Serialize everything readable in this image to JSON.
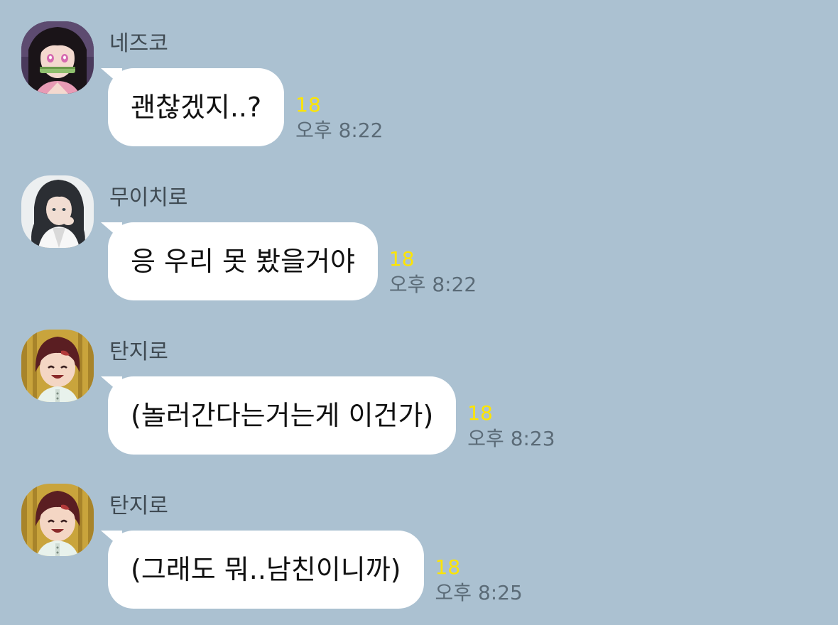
{
  "messages": [
    {
      "sender": "네즈코",
      "text": "괜찮겠지..?",
      "unread": "18",
      "time": "오후 8:22",
      "avatar": "nezuko-avatar"
    },
    {
      "sender": "무이치로",
      "text": "응 우리 못 봤을거야",
      "unread": "18",
      "time": "오후 8:22",
      "avatar": "muichiro-avatar"
    },
    {
      "sender": "탄지로",
      "text": "(놀러간다는거는게 이건가)",
      "unread": "18",
      "time": "오후 8:23",
      "avatar": "tanjiro-avatar"
    },
    {
      "sender": "탄지로",
      "text": "(그래도 뭐..남친이니까)",
      "unread": "18",
      "time": "오후 8:25",
      "avatar": "tanjiro-avatar"
    }
  ],
  "colors": {
    "background": "#abc1d1",
    "bubble": "#ffffff",
    "unread": "#fee500",
    "time": "#5b6b77"
  }
}
